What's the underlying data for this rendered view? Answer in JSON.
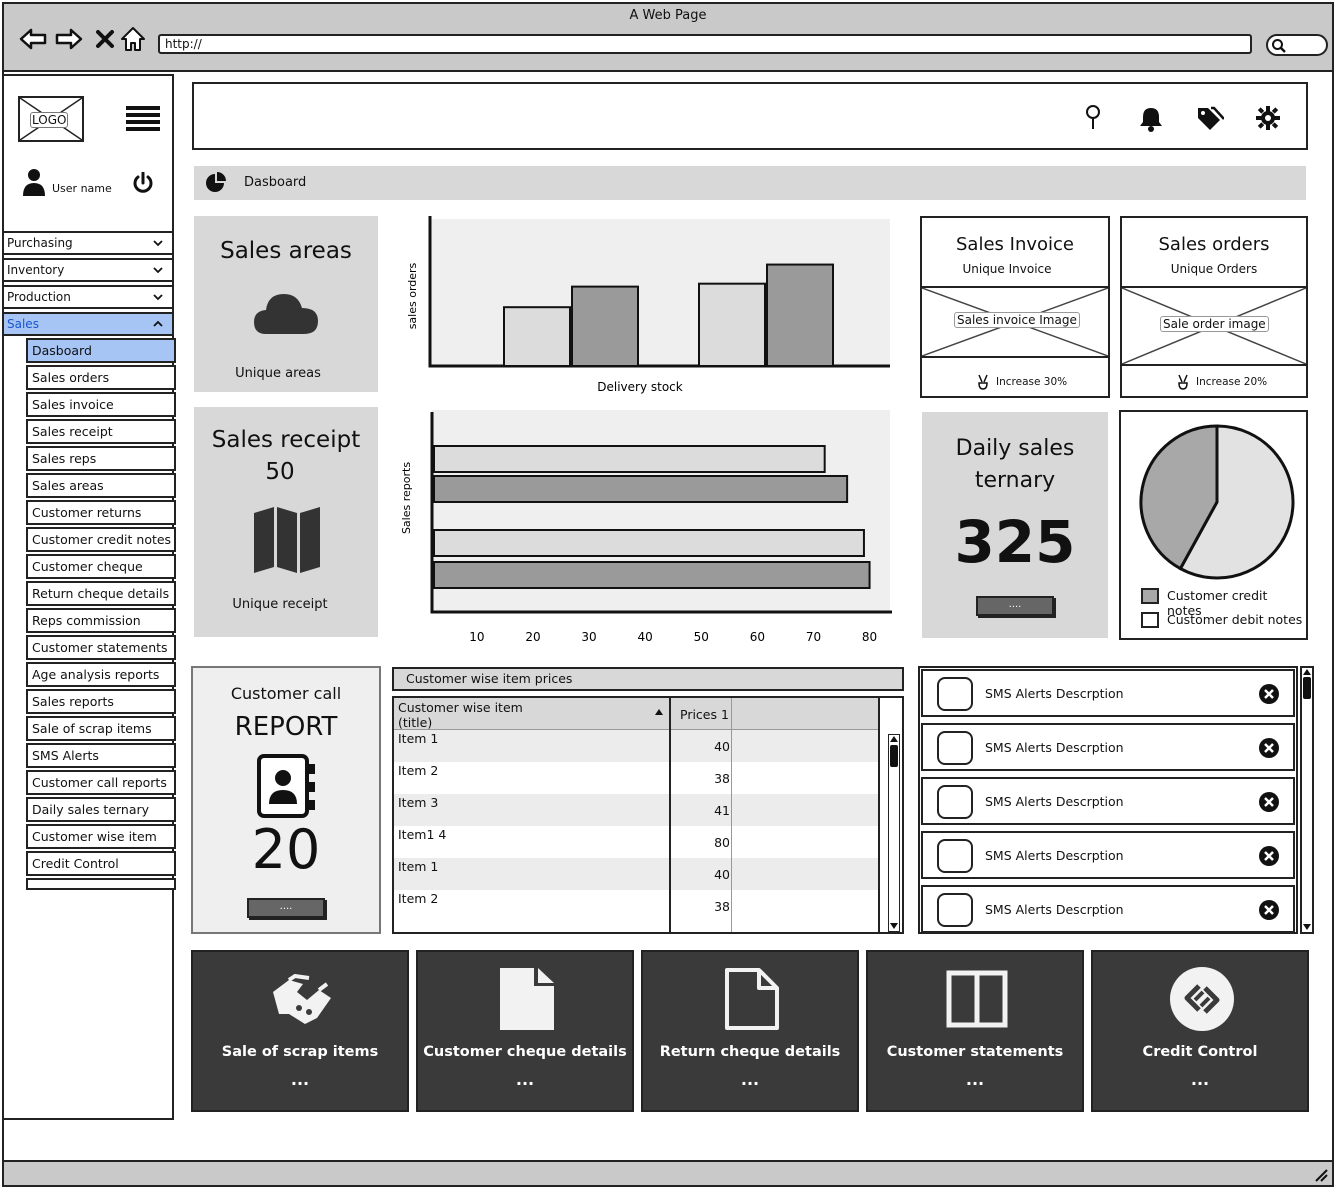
{
  "window": {
    "title": "A Web Page",
    "url": "http://"
  },
  "sidebar": {
    "logo_text": "LOGO",
    "user_name": "User name",
    "sections": [
      {
        "label": "Purchasing",
        "expanded": false
      },
      {
        "label": "Inventory",
        "expanded": false
      },
      {
        "label": "Production",
        "expanded": false
      },
      {
        "label": "Sales",
        "expanded": true
      }
    ],
    "sales_items": [
      "Dasboard",
      "Sales orders",
      "Sales invoice",
      "Sales receipt",
      "Sales reps",
      "Sales areas",
      "Customer returns",
      "Customer credit notes",
      "Customer cheque",
      "Return cheque details",
      "Reps commission",
      "Customer statements",
      "Age analysis reports",
      "Sales reports",
      "Sale of scrap items",
      "SMS Alerts",
      "Customer call reports",
      "Daily sales ternary",
      "Customer wise item",
      "Credit Control",
      ""
    ],
    "active_item": "Dasboard"
  },
  "header": {
    "icons": [
      "map-pin-icon",
      "bell-icon",
      "tags-icon",
      "gear-icon"
    ]
  },
  "breadcrumb": {
    "label": "Dasboard"
  },
  "sales_areas": {
    "title": "Sales areas",
    "caption": "Unique areas"
  },
  "sales_receipt": {
    "title": "Sales receipt",
    "value": "50",
    "caption": "Unique receipt"
  },
  "sales_invoice": {
    "title": "Sales Invoice",
    "subtitle": "Unique Invoice",
    "image_label": "Sales invoice Image",
    "footer": "Increase 30%"
  },
  "sales_orders": {
    "title": "Sales orders",
    "subtitle": "Unique Orders",
    "image_label": "Sale order image",
    "footer": "Increase 20%"
  },
  "daily_sales": {
    "title_line1": "Daily sales",
    "title_line2": "ternary",
    "value": "325",
    "button_label": "...."
  },
  "pie": {
    "legend": [
      "Customer credit notes",
      "Customer debit notes"
    ]
  },
  "customer_call": {
    "title": "Customer call",
    "subtitle": "REPORT",
    "value": "20",
    "button_label": "...."
  },
  "price_table": {
    "title": "Customer wise item prices",
    "columns": [
      "Customer wise item\n(title)",
      "Prices 1"
    ],
    "rows": [
      {
        "item": "Item 1",
        "price": "40"
      },
      {
        "item": "Item 2",
        "price": "38"
      },
      {
        "item": "Item 3",
        "price": "41"
      },
      {
        "item": "Item1 4",
        "price": "80"
      },
      {
        "item": "Item 1",
        "price": "40"
      },
      {
        "item": "Item 2",
        "price": "38"
      }
    ]
  },
  "sms_alerts": [
    "SMS Alerts Descrption",
    "SMS Alerts Descrption",
    "SMS Alerts Descrption",
    "SMS Alerts Descrption",
    "SMS Alerts Descrption"
  ],
  "tiles": [
    {
      "label": "Sale of scrap items",
      "dots": "...",
      "icon": "handshake-icon"
    },
    {
      "label": "Customer cheque details",
      "dots": "...",
      "icon": "file-icon"
    },
    {
      "label": "Return cheque details",
      "dots": "...",
      "icon": "file-outline-icon"
    },
    {
      "label": "Customer statements",
      "dots": "...",
      "icon": "columns-icon"
    },
    {
      "label": "Credit Control",
      "dots": "...",
      "icon": "link-circle-icon"
    }
  ],
  "chart_data": [
    {
      "type": "bar",
      "orientation": "vertical",
      "xlabel": "Delivery stock",
      "ylabel": "sales orders",
      "categories": [
        "",
        ""
      ],
      "series": [
        {
          "values": [
            40,
            54
          ]
        },
        {
          "values": [
            56,
            69
          ]
        }
      ],
      "ylim": [
        0,
        100
      ],
      "colors": [
        "#dcdcdc",
        "#9a9a9a"
      ]
    },
    {
      "type": "bar",
      "orientation": "horizontal",
      "ylabel": "Sales reports",
      "x_ticks": [
        10,
        20,
        30,
        40,
        50,
        60,
        70,
        80
      ],
      "xlim": [
        2,
        84
      ],
      "values": [
        72,
        76,
        79,
        80
      ],
      "colors": [
        "#dcdcdc",
        "#9a9a9a",
        "#dcdcdc",
        "#9a9a9a"
      ]
    },
    {
      "type": "pie",
      "labels": [
        "Customer credit notes",
        "Customer debit notes"
      ],
      "values": [
        58,
        42
      ],
      "colors": [
        "#e2e2e2",
        "#a8a8a8"
      ]
    }
  ]
}
